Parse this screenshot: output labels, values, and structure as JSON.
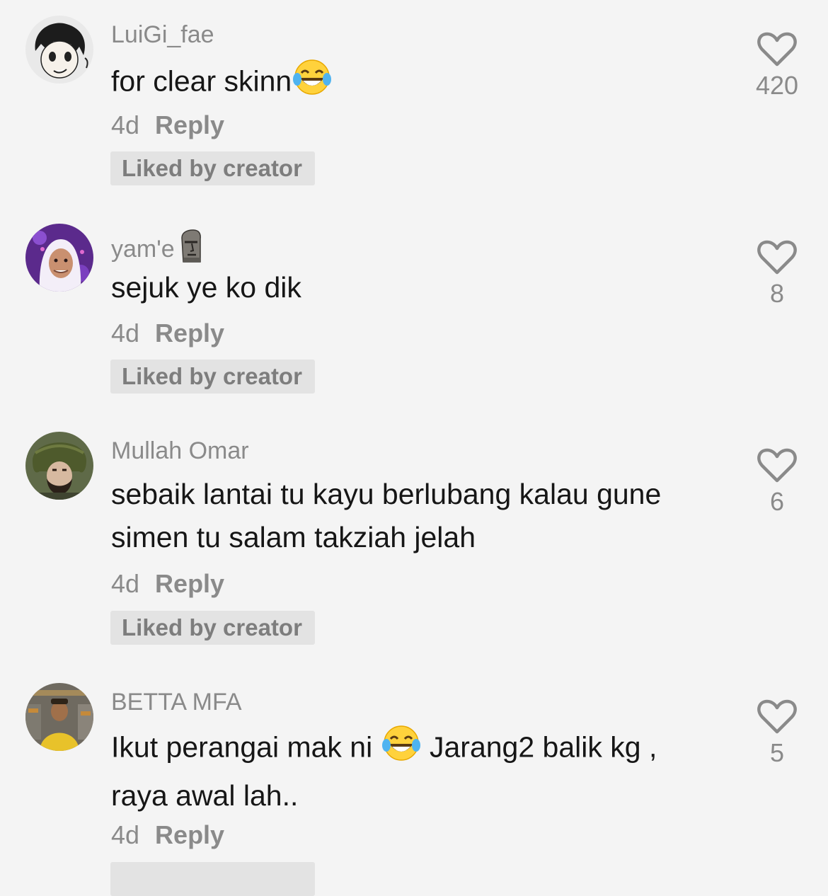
{
  "comments": [
    {
      "username": "LuiGi_fae",
      "text": "for clear skinn",
      "text_after_emoji": "",
      "text_line2": "",
      "emoji": "face-with-tears-of-joy",
      "time": "4d",
      "reply_label": "Reply",
      "badge": "Liked by creator",
      "likes": "420"
    },
    {
      "username": "yam'e",
      "username_emoji": "moai",
      "text": "sejuk ye ko dik",
      "time": "4d",
      "reply_label": "Reply",
      "badge": "Liked by creator",
      "likes": "8"
    },
    {
      "username": "Mullah Omar",
      "text": "sebaik lantai tu kayu berlubang kalau gune",
      "text_line2": "simen tu salam takziah jelah",
      "time": "4d",
      "reply_label": "Reply",
      "badge": "Liked by creator",
      "likes": "6"
    },
    {
      "username": "BETTA MFA",
      "text": "Ikut perangai mak ni ",
      "emoji": "face-with-tears-of-joy",
      "text_after_emoji": " Jarang2 balik kg ,",
      "text_line2": "raya awal lah..",
      "time": "4d",
      "reply_label": "Reply",
      "likes": "5"
    }
  ],
  "colors": {
    "background": "#f4f4f4",
    "text": "#161616",
    "muted": "#8a8a8a",
    "badge_bg": "#e3e3e3"
  }
}
